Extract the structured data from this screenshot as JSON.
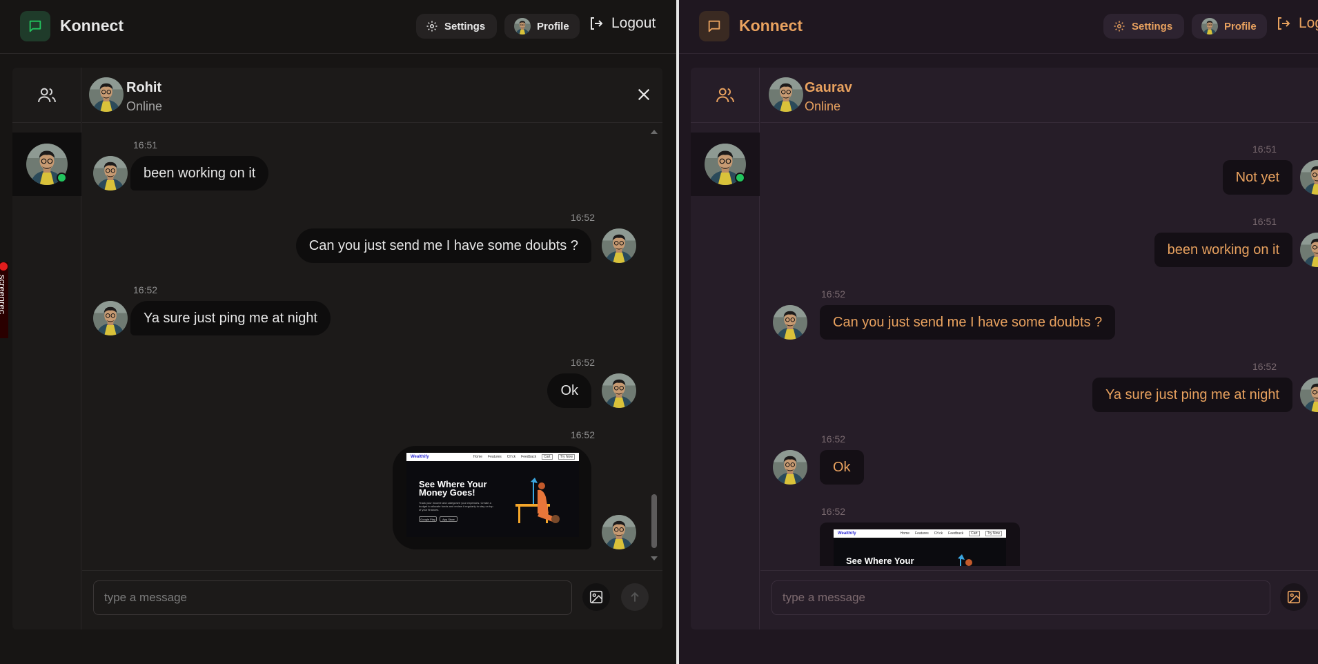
{
  "app": {
    "brand": "Konnect",
    "settings_label": "Settings",
    "profile_label": "Profile",
    "logout_label": "Logout",
    "input_placeholder": "type a message",
    "screenrec_label": "screenrec"
  },
  "colors": {
    "left_bg": "#171514",
    "right_bg": "#1f1720",
    "online": "#22c55e",
    "accent_right": "#e9a25f"
  },
  "left": {
    "contact": {
      "name": "Rohit",
      "status": "Online"
    },
    "messages": [
      {
        "time": "16:51",
        "text": "been working on it",
        "side": "received"
      },
      {
        "time": "16:52",
        "text": "Can you just send me I have some doubts ?",
        "side": "sent"
      },
      {
        "time": "16:52",
        "text": "Ya sure just ping me at night",
        "side": "received"
      },
      {
        "time": "16:52",
        "text": "Ok",
        "side": "sent"
      },
      {
        "time": "16:52",
        "image": true,
        "side": "sent"
      }
    ]
  },
  "right": {
    "contact": {
      "name": "Gaurav",
      "status": "Online"
    },
    "messages": [
      {
        "time": "16:51",
        "text": "Not yet",
        "side": "sent"
      },
      {
        "time": "16:51",
        "text": "been working on it",
        "side": "sent"
      },
      {
        "time": "16:52",
        "text": "Can you just send me I have some doubts ?",
        "side": "received"
      },
      {
        "time": "16:52",
        "text": "Ya sure just ping me at night",
        "side": "sent"
      },
      {
        "time": "16:52",
        "text": "Ok",
        "side": "received"
      },
      {
        "time": "16:52",
        "image": true,
        "side": "received"
      }
    ]
  },
  "shared_image": {
    "site_name": "Wealthify",
    "nav": [
      "Home",
      "Features",
      "Ch'ck",
      "Feedback",
      "Cart",
      "Try Now"
    ],
    "headline": "See Where Your Money Goes!",
    "subtext": "Track your income and categorize your expenses. Create a budget to allocate funds and review it regularly to stay on top of your finances.",
    "store_1": "Google Play",
    "store_2": "App Store"
  }
}
